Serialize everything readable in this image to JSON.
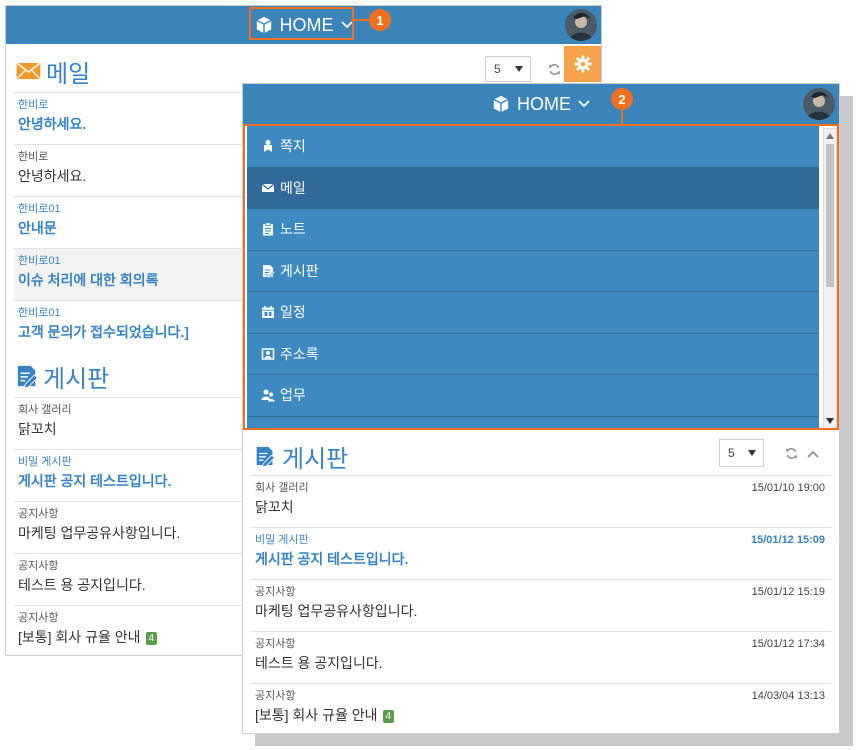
{
  "colors": {
    "header_blue": "#3b84b9",
    "menu_blue": "#3e89bf",
    "menu_active": "#31699a",
    "link_blue": "#3783c3",
    "callout_orange": "#f0701f",
    "badge_green": "#5b9d4a",
    "gear_orange": "#f6a24a"
  },
  "callouts": {
    "first": "1",
    "second": "2"
  },
  "back_screen": {
    "header": {
      "title": "HOME",
      "title_icon": "cube-icon",
      "dropdown_icon": "chevron-down-icon",
      "avatar_icon": "user-avatar-icon"
    },
    "mail": {
      "title": "메일",
      "icon": "envelope-icon",
      "page_size": "5",
      "items": [
        {
          "sender": "한비로",
          "subject": "안녕하세요.",
          "unread": true,
          "highlighted": false
        },
        {
          "sender": "한비로",
          "subject": "안녕하세요.",
          "unread": false,
          "highlighted": false
        },
        {
          "sender": "한비로01",
          "subject": "안내문",
          "unread": true,
          "highlighted": false
        },
        {
          "sender": "한비로01",
          "subject": "이슈 처리에 대한 회의록",
          "unread": true,
          "highlighted": true
        },
        {
          "sender": "한비로01",
          "subject": "고객 문의가 접수되었습니다.]",
          "unread": true,
          "highlighted": false
        }
      ]
    },
    "board": {
      "title": "게시판",
      "icon": "board-edit-icon",
      "items": [
        {
          "category": "회사 갤러리",
          "subject": "닭꼬치",
          "unread": false
        },
        {
          "category": "비밀 게시판",
          "subject": "게시판 공지 테스트입니다.",
          "unread": true
        },
        {
          "category": "공지사항",
          "subject": "마케팅 업무공유사항입니다.",
          "unread": false
        },
        {
          "category": "공지사항",
          "subject": "테스트 용 공지입니다.",
          "unread": false
        },
        {
          "category": "공지사항",
          "subject": "[보통] 회사 규율 안내",
          "badge": "4",
          "unread": false
        }
      ]
    }
  },
  "front_screen": {
    "header": {
      "title": "HOME",
      "title_icon": "cube-icon",
      "dropdown_icon": "chevron-down-icon",
      "avatar_icon": "user-avatar-icon"
    },
    "menu": {
      "items": [
        {
          "label": "쪽지",
          "icon": "memo-icon",
          "active": false
        },
        {
          "label": "메일",
          "icon": "mail-icon",
          "active": true
        },
        {
          "label": "노트",
          "icon": "note-icon",
          "active": false
        },
        {
          "label": "게시판",
          "icon": "board-icon",
          "active": false
        },
        {
          "label": "일정",
          "icon": "calendar-icon",
          "active": false
        },
        {
          "label": "주소록",
          "icon": "contacts-icon",
          "active": false
        },
        {
          "label": "업무",
          "icon": "task-icon",
          "active": false
        }
      ]
    },
    "board": {
      "title": "게시판",
      "icon": "board-edit-icon",
      "page_size": "5",
      "items": [
        {
          "category": "회사 갤러리",
          "subject": "닭꼬치",
          "date": "15/01/10 19:00",
          "unread": false
        },
        {
          "category": "비밀 게시판",
          "subject": "게시판 공지 테스트입니다.",
          "date": "15/01/12 15:09",
          "unread": true
        },
        {
          "category": "공지사항",
          "subject": "마케팅 업무공유사항입니다.",
          "date": "15/01/12 15:19",
          "unread": false
        },
        {
          "category": "공지사항",
          "subject": "테스트 용 공지입니다.",
          "date": "15/01/12 17:34",
          "unread": false
        },
        {
          "category": "공지사항",
          "subject": "[보통] 회사 규율 안내",
          "badge": "4",
          "date": "14/03/04 13:13",
          "unread": false
        }
      ]
    }
  }
}
